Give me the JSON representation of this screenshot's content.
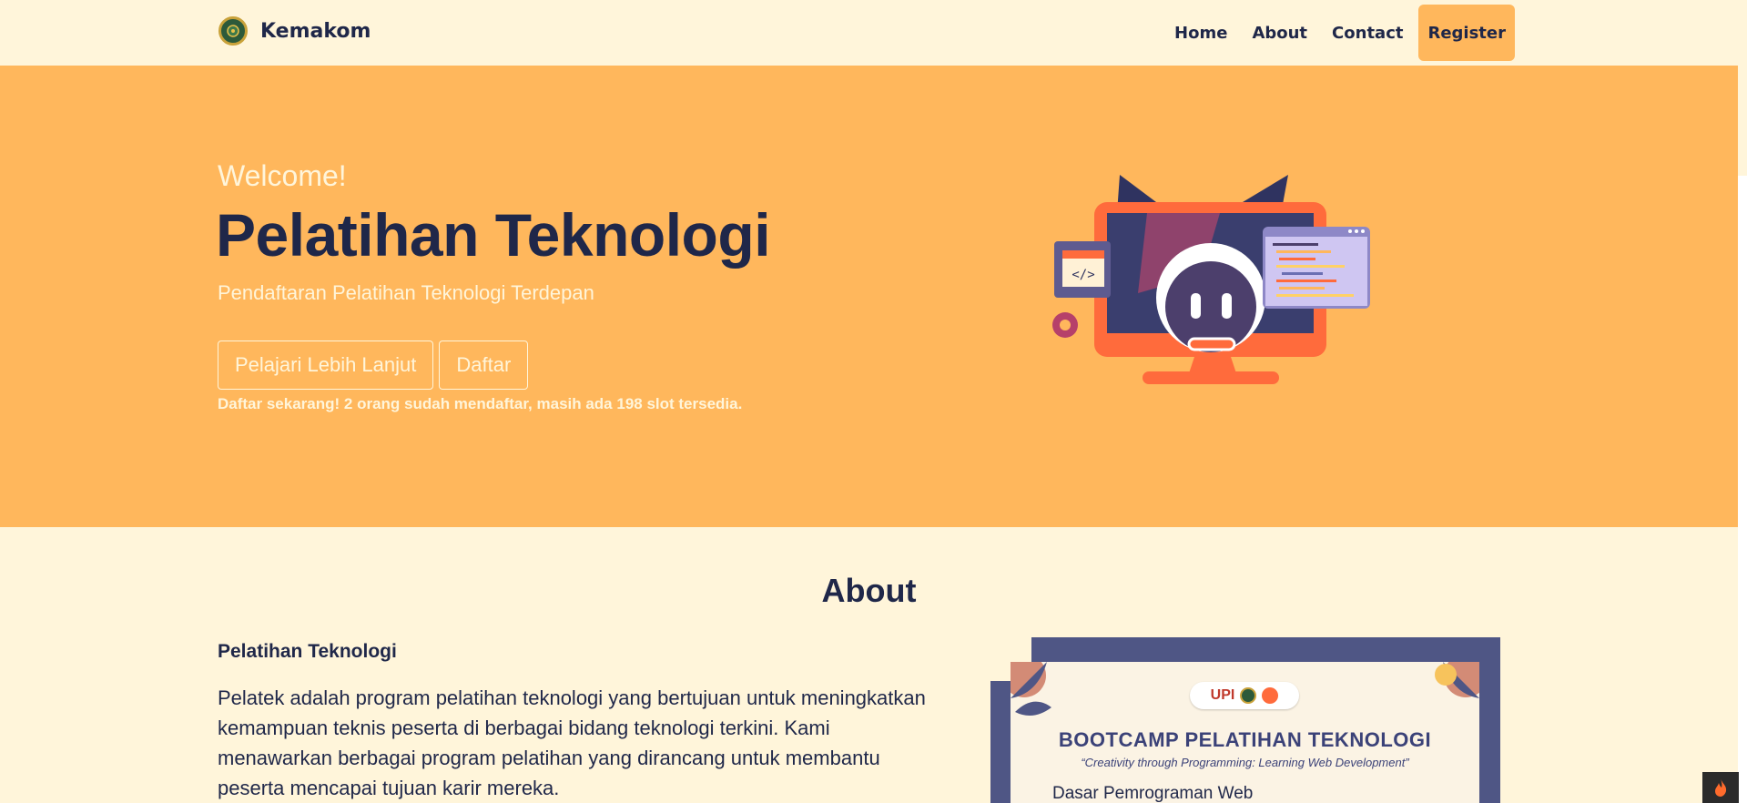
{
  "nav": {
    "brand": "Kemakom",
    "links": [
      "Home",
      "About",
      "Contact"
    ],
    "register": "Register"
  },
  "hero": {
    "welcome": "Welcome!",
    "title": "Pelatihan Teknologi",
    "subtitle": "Pendaftaran Pelatihan Teknologi Terdepan",
    "buttons": [
      "Pelajari Lebih Lanjut",
      "Daftar"
    ],
    "note": "Daftar sekarang! 2 orang sudah mendaftar, masih ada 198 slot tersedia."
  },
  "about": {
    "heading": "About",
    "subheading": "Pelatihan Teknologi",
    "text": "Pelatek adalah program pelatihan teknologi yang bertujuan untuk meningkatkan kemampuan teknis peserta di berbagai bidang teknologi terkini. Kami menawarkan berbagai program pelatihan yang dirancang untuk membantu peserta mencapai tujuan karir mereka.",
    "poster": {
      "title": "BOOTCAMP PELATIHAN TEKNOLOGI",
      "tagline": "“Creativity through Programming: Learning Web Development”",
      "course": "Dasar Pemrograman Web",
      "logo_text": "UPI"
    }
  },
  "colors": {
    "background": "#fff5da",
    "hero": "#ffb75c",
    "navy": "#1f2749",
    "poster_frame": "#4f5685"
  },
  "icons": {
    "brand": "university-seal-icon",
    "illustration": "computer-robot-illustration",
    "corner": "flame-icon"
  }
}
